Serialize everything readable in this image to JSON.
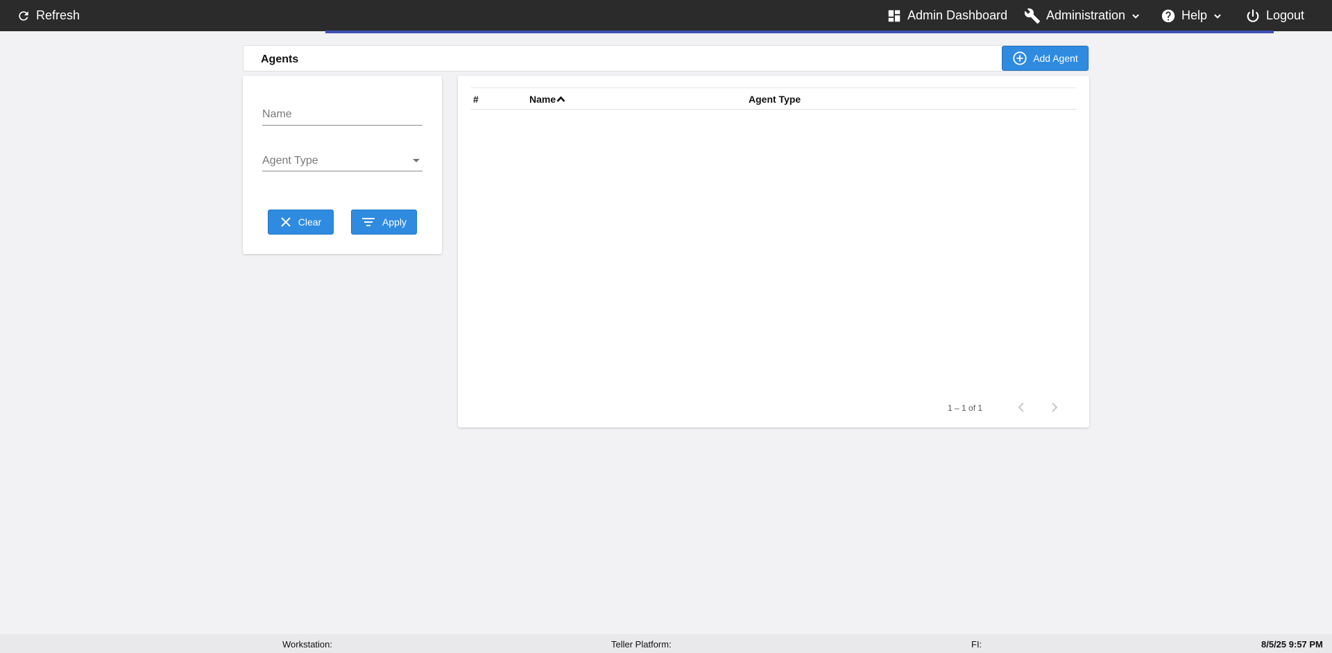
{
  "navbar": {
    "refresh_label": "Refresh",
    "dashboard_label": "Admin Dashboard",
    "administration_label": "Administration",
    "help_label": "Help",
    "logout_label": "Logout",
    "accent_color": "#3f51b5"
  },
  "header": {
    "title": "Agents",
    "add_button_label": "Add Agent"
  },
  "filters": {
    "name_placeholder": "Name",
    "agent_type_label": "Agent Type",
    "clear_label": "Clear",
    "apply_label": "Apply"
  },
  "table": {
    "columns": [
      "#",
      "Name",
      "Agent Type"
    ],
    "sorted_column": "Name",
    "rows": []
  },
  "paginator": {
    "range_label": "1 – 1 of 1"
  },
  "footer": {
    "workstation_label": "Workstation:",
    "teller_platform_label": "Teller Platform:",
    "fi_label": "FI:",
    "datetime": "8/5/25 9:57 PM"
  },
  "colors": {
    "primary_button": "#2f8be0",
    "navbar_bg": "#2b2b2b",
    "page_bg": "#f2f2f4"
  }
}
